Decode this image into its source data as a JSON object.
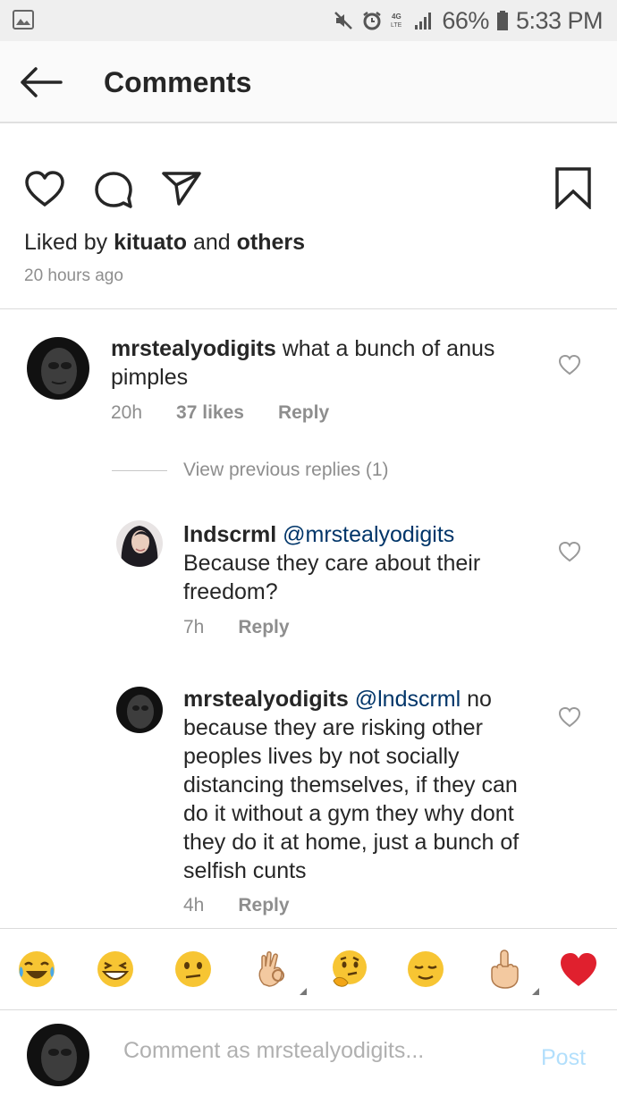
{
  "status_bar": {
    "battery": "66%",
    "time": "5:33 PM",
    "network": "4G LTE"
  },
  "header": {
    "title": "Comments"
  },
  "post": {
    "liked_by_prefix": "Liked by ",
    "liked_by_user": "kituato",
    "liked_by_mid": " and ",
    "liked_by_others": "others",
    "time_ago": "20 hours ago"
  },
  "comments": [
    {
      "username": "mrstealyodigits",
      "mention": "",
      "text": " what a bunch of anus pimples",
      "time": "20h",
      "likes": "37 likes",
      "reply_label": "Reply"
    }
  ],
  "view_previous_replies": "View previous replies (1)",
  "replies": [
    {
      "username": "lndscrml",
      "mention": "@mrstealyodigits",
      "text": "Because they care about their freedom?",
      "time": "7h",
      "reply_label": "Reply"
    },
    {
      "username": "mrstealyodigits",
      "mention": "@lndscrml",
      "text": "no because they are risking other peoples lives by not socially distancing themselves, if they can do it without a gym they why dont they do it at home, just a bunch of selfish cunts",
      "time": "4h",
      "reply_label": "Reply"
    }
  ],
  "emoji_bar": [
    "face-with-tears-of-joy",
    "grinning-squinting",
    "neutral-face",
    "ok-hand",
    "thinking-face",
    "relieved-face",
    "raised-finger",
    "red-heart"
  ],
  "compose": {
    "placeholder": "Comment as mrstealyodigits...",
    "post_label": "Post"
  },
  "colors": {
    "accent_link": "#003569",
    "post_disabled": "#b2dffc",
    "meta_gray": "#8e8e8e",
    "heart_red": "#e0202e"
  }
}
